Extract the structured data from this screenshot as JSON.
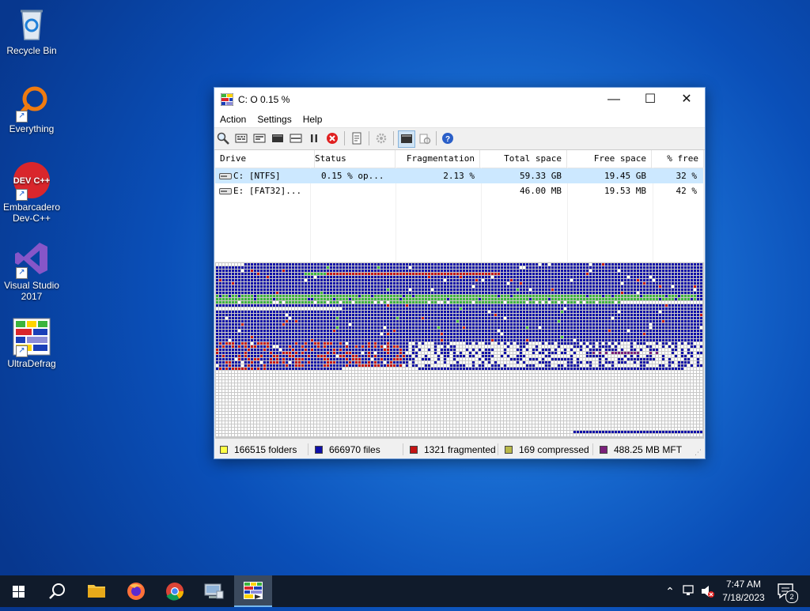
{
  "desktop": {
    "icons": [
      {
        "label": "Recycle Bin",
        "icon": "recycle-bin-icon"
      },
      {
        "label": "Everything",
        "icon": "everything-search-icon"
      },
      {
        "label": "Embarcadero Dev-C++",
        "icon": "devcpp-icon",
        "icon_text": "DEV C++"
      },
      {
        "label": "Visual Studio 2017",
        "icon": "visual-studio-icon"
      },
      {
        "label": "UltraDefrag",
        "icon": "ultradefrag-icon"
      }
    ]
  },
  "window": {
    "title": "C:  O  0.15 %",
    "controls": {
      "minimize": "—",
      "maximize": "☐",
      "close": "✕"
    },
    "menu": [
      "Action",
      "Settings",
      "Help"
    ],
    "toolbar": [
      "analyze-icon",
      "defrag-icon",
      "quick-optimize-icon",
      "full-optimize-icon",
      "mft-optimize-icon",
      "pause-icon",
      "stop-icon",
      "report-icon",
      "preferences-icon",
      "boot-time-icon",
      "script-icon",
      "help-icon"
    ],
    "columns": [
      "Drive",
      "Status",
      "Fragmentation",
      "Total space",
      "Free space",
      "% free"
    ],
    "rows": [
      {
        "drive": "C: [NTFS]",
        "status": "0.15 % op...",
        "fragmentation": "2.13 %",
        "total": "59.33 GB",
        "free": "19.45 GB",
        "pct_free": "32 %"
      },
      {
        "drive": "E: [FAT32]...",
        "status": "",
        "fragmentation": "",
        "total": "46.00 MB",
        "free": "19.53 MB",
        "pct_free": "42 %"
      }
    ],
    "status_bar": {
      "folders": "166515 folders",
      "files": "666970 files",
      "fragmented": "1321 fragmented",
      "compressed": "169 compressed",
      "mft": "488.25 MB MFT"
    },
    "colors": {
      "folders": "#ffff44",
      "files": "#0f0fa8",
      "fragmented": "#c41414",
      "compressed": "#b8b84a",
      "mft": "#7a1f7a",
      "free": "#ffffff",
      "system": "#3cb43c",
      "selection": "#cce8ff"
    }
  },
  "taskbar": {
    "apps": [
      "start-icon",
      "search-icon",
      "file-explorer-icon",
      "firefox-icon",
      "chrome-icon",
      "computer-management-icon",
      "ultradefrag-icon"
    ],
    "time": "7:47 AM",
    "date": "7/18/2023",
    "notifications": "2"
  }
}
